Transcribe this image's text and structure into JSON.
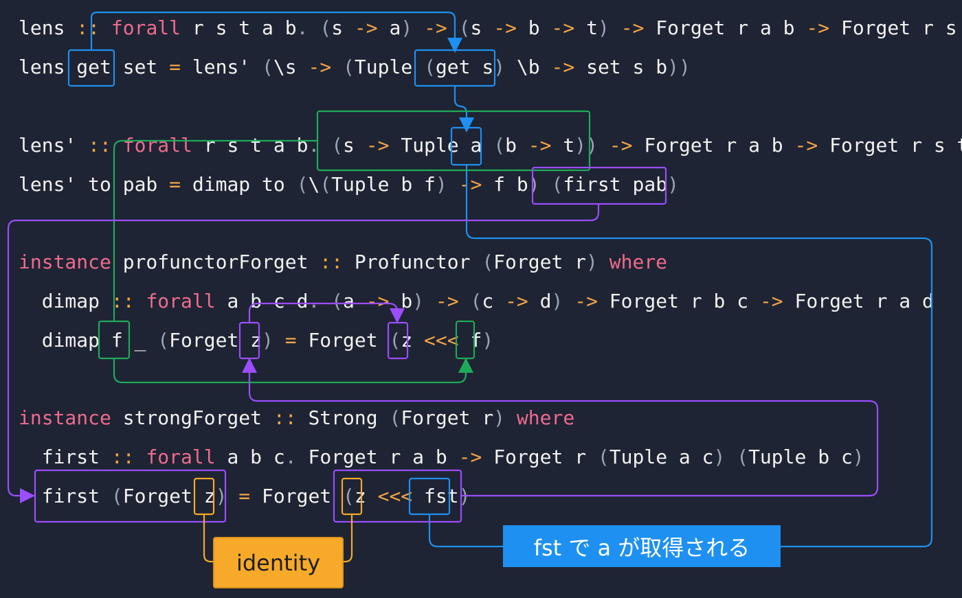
{
  "code_lines": [
    {
      "id": "l1",
      "tokens": [
        [
          "id",
          "lens "
        ],
        [
          "op",
          "::"
        ],
        [
          "id",
          " "
        ],
        [
          "kw",
          "forall"
        ],
        [
          "id",
          " r s t a b"
        ],
        [
          "pn",
          "."
        ],
        [
          "id",
          " "
        ],
        [
          "pn",
          "("
        ],
        [
          "id",
          "s "
        ],
        [
          "op",
          "->"
        ],
        [
          "id",
          " a"
        ],
        [
          "pn",
          ")"
        ],
        [
          "id",
          " "
        ],
        [
          "op",
          "->"
        ],
        [
          "id",
          " "
        ],
        [
          "pn",
          "("
        ],
        [
          "id",
          "s "
        ],
        [
          "op",
          "->"
        ],
        [
          "id",
          " b "
        ],
        [
          "op",
          "->"
        ],
        [
          "id",
          " t"
        ],
        [
          "pn",
          ")"
        ],
        [
          "id",
          " "
        ],
        [
          "op",
          "->"
        ],
        [
          "id",
          " Forget r a b "
        ],
        [
          "op",
          "->"
        ],
        [
          "id",
          " Forget r s t"
        ]
      ]
    },
    {
      "id": "l2",
      "tokens": [
        [
          "id",
          "lens get set "
        ],
        [
          "op",
          "="
        ],
        [
          "id",
          " lens' "
        ],
        [
          "pn",
          "("
        ],
        [
          "id",
          "\\s "
        ],
        [
          "op",
          "->"
        ],
        [
          "id",
          " "
        ],
        [
          "pn",
          "("
        ],
        [
          "id",
          "Tuple "
        ],
        [
          "pn",
          "("
        ],
        [
          "id",
          "get s"
        ],
        [
          "pn",
          ")"
        ],
        [
          "id",
          " \\b "
        ],
        [
          "op",
          "->"
        ],
        [
          "id",
          " set s b"
        ],
        [
          "pn",
          "))"
        ]
      ]
    },
    {
      "id": "l3",
      "tokens": [
        [
          "id",
          "lens' "
        ],
        [
          "op",
          "::"
        ],
        [
          "id",
          " "
        ],
        [
          "kw",
          "forall"
        ],
        [
          "id",
          " r s t a b"
        ],
        [
          "pn",
          "."
        ],
        [
          "id",
          " "
        ],
        [
          "pn",
          "("
        ],
        [
          "id",
          "s "
        ],
        [
          "op",
          "->"
        ],
        [
          "id",
          " Tuple a "
        ],
        [
          "pn",
          "("
        ],
        [
          "id",
          "b "
        ],
        [
          "op",
          "->"
        ],
        [
          "id",
          " t"
        ],
        [
          "pn",
          "))"
        ],
        [
          "id",
          " "
        ],
        [
          "op",
          "->"
        ],
        [
          "id",
          " Forget r a b "
        ],
        [
          "op",
          "->"
        ],
        [
          "id",
          " Forget r s t"
        ]
      ]
    },
    {
      "id": "l4",
      "tokens": [
        [
          "id",
          "lens' to pab "
        ],
        [
          "op",
          "="
        ],
        [
          "id",
          " dimap to "
        ],
        [
          "pn",
          "("
        ],
        [
          "id",
          "\\"
        ],
        [
          "pn",
          "("
        ],
        [
          "id",
          "Tuple b f"
        ],
        [
          "pn",
          ")"
        ],
        [
          "id",
          " "
        ],
        [
          "op",
          "->"
        ],
        [
          "id",
          " f b"
        ],
        [
          "pn",
          ")"
        ],
        [
          "id",
          " "
        ],
        [
          "pn",
          "("
        ],
        [
          "id",
          "first pab"
        ],
        [
          "pn",
          ")"
        ]
      ]
    },
    {
      "id": "l5",
      "tokens": [
        [
          "kw",
          "instance"
        ],
        [
          "id",
          " profunctorForget "
        ],
        [
          "op",
          "::"
        ],
        [
          "id",
          " Profunctor "
        ],
        [
          "pn",
          "("
        ],
        [
          "id",
          "Forget r"
        ],
        [
          "pn",
          ")"
        ],
        [
          "id",
          " "
        ],
        [
          "kw",
          "where"
        ]
      ]
    },
    {
      "id": "l6",
      "tokens": [
        [
          "id",
          "  dimap "
        ],
        [
          "op",
          "::"
        ],
        [
          "id",
          " "
        ],
        [
          "kw",
          "forall"
        ],
        [
          "id",
          " a b c d"
        ],
        [
          "pn",
          "."
        ],
        [
          "id",
          " "
        ],
        [
          "pn",
          "("
        ],
        [
          "id",
          "a "
        ],
        [
          "op",
          "->"
        ],
        [
          "id",
          " b"
        ],
        [
          "pn",
          ")"
        ],
        [
          "id",
          " "
        ],
        [
          "op",
          "->"
        ],
        [
          "id",
          " "
        ],
        [
          "pn",
          "("
        ],
        [
          "id",
          "c "
        ],
        [
          "op",
          "->"
        ],
        [
          "id",
          " d"
        ],
        [
          "pn",
          ")"
        ],
        [
          "id",
          " "
        ],
        [
          "op",
          "->"
        ],
        [
          "id",
          " Forget r b c "
        ],
        [
          "op",
          "->"
        ],
        [
          "id",
          " Forget r a d"
        ]
      ]
    },
    {
      "id": "l7",
      "tokens": [
        [
          "id",
          "  dimap f _ "
        ],
        [
          "pn",
          "("
        ],
        [
          "id",
          "Forget z"
        ],
        [
          "pn",
          ")"
        ],
        [
          "id",
          " "
        ],
        [
          "op",
          "="
        ],
        [
          "id",
          " Forget "
        ],
        [
          "pn",
          "("
        ],
        [
          "id",
          "z "
        ],
        [
          "op",
          "<<<"
        ],
        [
          "id",
          " f"
        ],
        [
          "pn",
          ")"
        ]
      ]
    },
    {
      "id": "l8",
      "tokens": [
        [
          "kw",
          "instance"
        ],
        [
          "id",
          " strongForget "
        ],
        [
          "op",
          "::"
        ],
        [
          "id",
          " Strong "
        ],
        [
          "pn",
          "("
        ],
        [
          "id",
          "Forget r"
        ],
        [
          "pn",
          ")"
        ],
        [
          "id",
          " "
        ],
        [
          "kw",
          "where"
        ]
      ]
    },
    {
      "id": "l9",
      "tokens": [
        [
          "id",
          "  first "
        ],
        [
          "op",
          "::"
        ],
        [
          "id",
          " "
        ],
        [
          "kw",
          "forall"
        ],
        [
          "id",
          " a b c"
        ],
        [
          "pn",
          "."
        ],
        [
          "id",
          " Forget r a b "
        ],
        [
          "op",
          "->"
        ],
        [
          "id",
          " Forget r "
        ],
        [
          "pn",
          "("
        ],
        [
          "id",
          "Tuple a c"
        ],
        [
          "pn",
          ")"
        ],
        [
          "id",
          " "
        ],
        [
          "pn",
          "("
        ],
        [
          "id",
          "Tuple b c"
        ],
        [
          "pn",
          ")"
        ]
      ]
    },
    {
      "id": "l10",
      "tokens": [
        [
          "id",
          "  first "
        ],
        [
          "pn",
          "("
        ],
        [
          "id",
          "Forget z"
        ],
        [
          "pn",
          ")"
        ],
        [
          "id",
          " "
        ],
        [
          "op",
          "="
        ],
        [
          "id",
          " Forget "
        ],
        [
          "pn",
          "("
        ],
        [
          "id",
          "z "
        ],
        [
          "op",
          "<<<"
        ],
        [
          "id",
          " fst"
        ],
        [
          "pn",
          ")"
        ]
      ]
    }
  ],
  "labels": {
    "identity": "identity",
    "fst_note": "fst で a が取得される"
  },
  "colors": {
    "background": "#1e2433",
    "blue": "#1e90f2",
    "green": "#1faa5a",
    "purple": "#9b4dff",
    "orange": "#f7a92a",
    "keyword": "#f06b8e",
    "operator": "#f5a445"
  }
}
